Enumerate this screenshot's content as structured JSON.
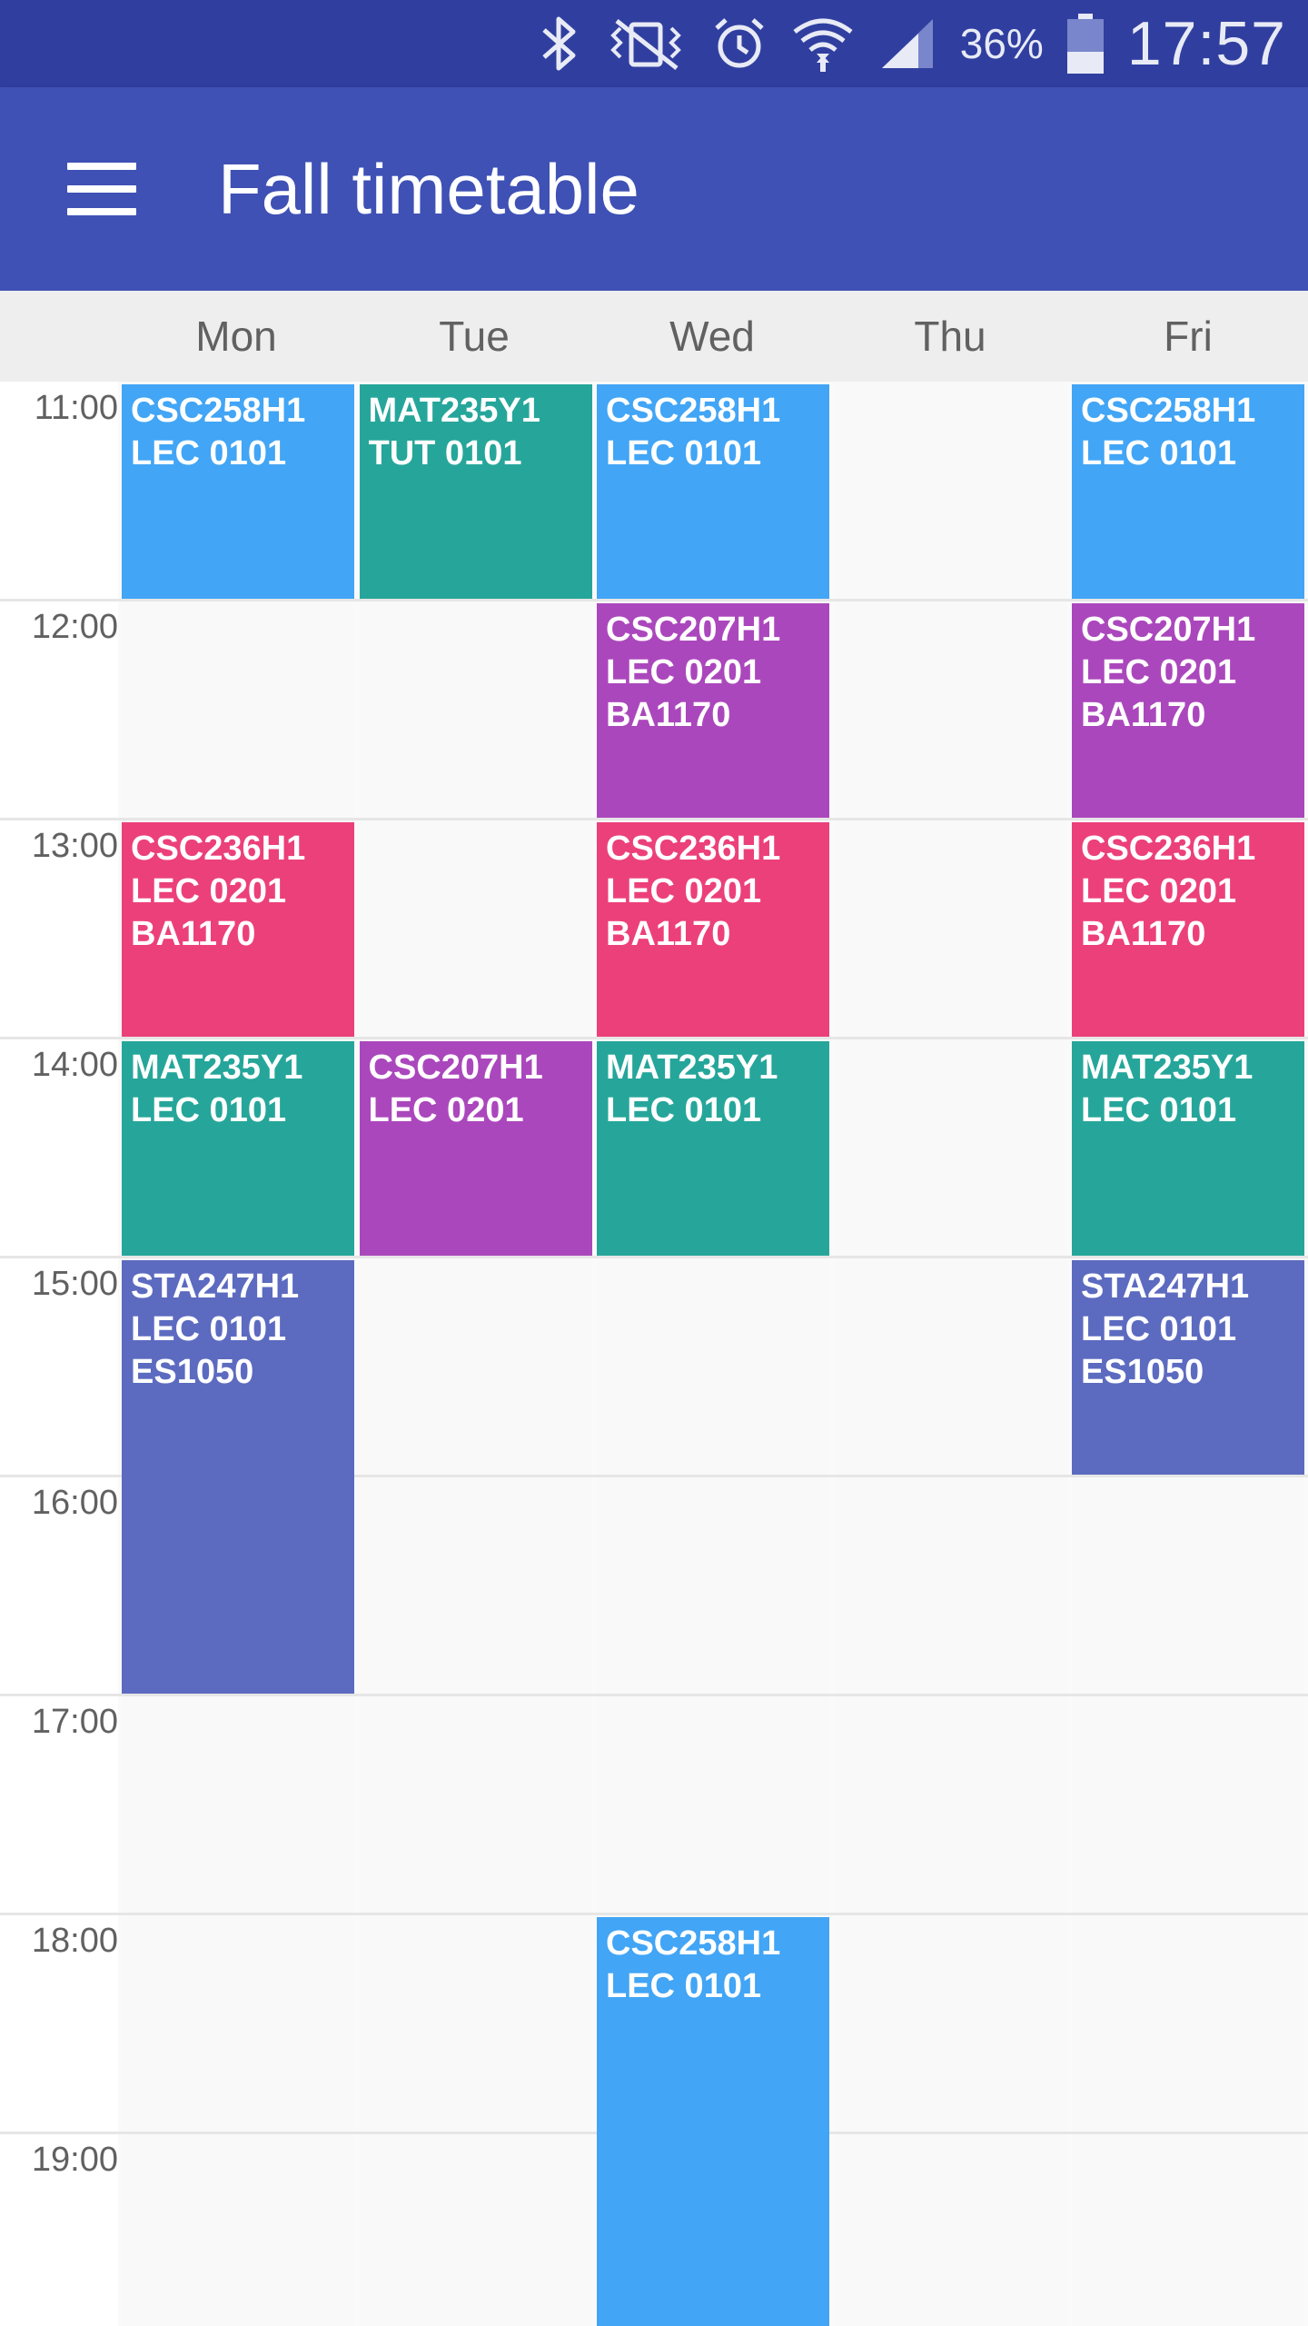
{
  "status_bar": {
    "battery_percent": "36%",
    "time": "17:57",
    "icons": [
      "bluetooth-icon",
      "vibrate-icon",
      "alarm-icon",
      "wifi-icon",
      "signal-icon",
      "battery-icon"
    ]
  },
  "app_bar": {
    "title": "Fall timetable",
    "menu_icon": "menu-icon"
  },
  "days": [
    "Mon",
    "Tue",
    "Wed",
    "Thu",
    "Fri"
  ],
  "hours": [
    "11:00",
    "12:00",
    "13:00",
    "14:00",
    "15:00",
    "16:00",
    "17:00",
    "18:00",
    "19:00"
  ],
  "colors": {
    "status_bar": "#303f9f",
    "app_bar": "#3f51b5",
    "CSC258H1": "#42a5f5",
    "MAT235Y1": "#26a69a",
    "CSC207H1": "#ab47bc",
    "CSC236H1": "#ec407a",
    "STA247H1": "#5c6bc0"
  },
  "events": [
    {
      "day": "Mon",
      "start": "11:00",
      "end": "12:00",
      "course": "CSC258H1",
      "section": "LEC 0101",
      "room": ""
    },
    {
      "day": "Mon",
      "start": "13:00",
      "end": "14:00",
      "course": "CSC236H1",
      "section": "LEC 0201",
      "room": "BA1170"
    },
    {
      "day": "Mon",
      "start": "14:00",
      "end": "15:00",
      "course": "MAT235Y1",
      "section": "LEC 0101",
      "room": ""
    },
    {
      "day": "Mon",
      "start": "15:00",
      "end": "17:00",
      "course": "STA247H1",
      "section": "LEC 0101",
      "room": "ES1050"
    },
    {
      "day": "Tue",
      "start": "11:00",
      "end": "12:00",
      "course": "MAT235Y1",
      "section": "TUT 0101",
      "room": ""
    },
    {
      "day": "Tue",
      "start": "14:00",
      "end": "15:00",
      "course": "CSC207H1",
      "section": "LEC 0201",
      "room": ""
    },
    {
      "day": "Wed",
      "start": "11:00",
      "end": "12:00",
      "course": "CSC258H1",
      "section": "LEC 0101",
      "room": ""
    },
    {
      "day": "Wed",
      "start": "12:00",
      "end": "13:00",
      "course": "CSC207H1",
      "section": "LEC 0201",
      "room": "BA1170"
    },
    {
      "day": "Wed",
      "start": "13:00",
      "end": "14:00",
      "course": "CSC236H1",
      "section": "LEC 0201",
      "room": "BA1170"
    },
    {
      "day": "Wed",
      "start": "14:00",
      "end": "15:00",
      "course": "MAT235Y1",
      "section": "LEC 0101",
      "room": ""
    },
    {
      "day": "Wed",
      "start": "18:00",
      "end": "20:00",
      "course": "CSC258H1",
      "section": "LEC 0101",
      "room": ""
    },
    {
      "day": "Fri",
      "start": "11:00",
      "end": "12:00",
      "course": "CSC258H1",
      "section": "LEC 0101",
      "room": ""
    },
    {
      "day": "Fri",
      "start": "12:00",
      "end": "13:00",
      "course": "CSC207H1",
      "section": "LEC 0201",
      "room": "BA1170"
    },
    {
      "day": "Fri",
      "start": "13:00",
      "end": "14:00",
      "course": "CSC236H1",
      "section": "LEC 0201",
      "room": "BA1170"
    },
    {
      "day": "Fri",
      "start": "14:00",
      "end": "15:00",
      "course": "MAT235Y1",
      "section": "LEC 0101",
      "room": ""
    },
    {
      "day": "Fri",
      "start": "15:00",
      "end": "16:00",
      "course": "STA247H1",
      "section": "LEC 0101",
      "room": "ES1050"
    }
  ]
}
